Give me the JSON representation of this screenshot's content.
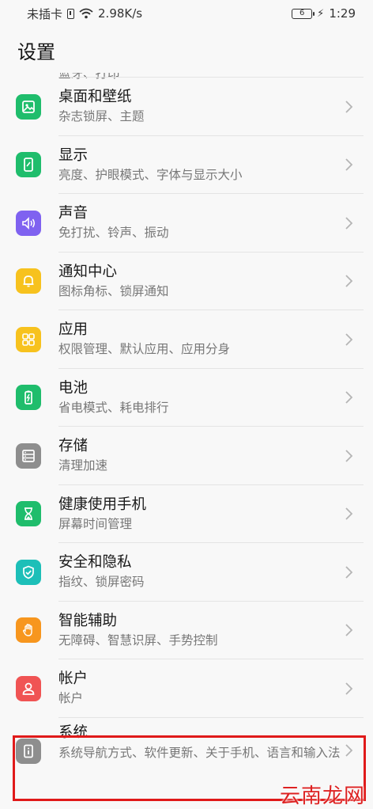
{
  "status_bar": {
    "carrier": "未插卡",
    "speed": "2.98K/s",
    "battery": "6",
    "time": "1:29"
  },
  "header": {
    "title": "设置"
  },
  "items": [
    {
      "title": "",
      "subtitle": "蓝牙、打印",
      "color": "#3d8bf2",
      "icon": "bluetooth-icon"
    },
    {
      "title": "桌面和壁纸",
      "subtitle": "杂志锁屏、主题",
      "color": "#1fbd6c",
      "icon": "wallpaper-icon"
    },
    {
      "title": "显示",
      "subtitle": "亮度、护眼模式、字体与显示大小",
      "color": "#1fbd6c",
      "icon": "display-icon"
    },
    {
      "title": "声音",
      "subtitle": "免打扰、铃声、振动",
      "color": "#7f62f0",
      "icon": "sound-icon"
    },
    {
      "title": "通知中心",
      "subtitle": "图标角标、锁屏通知",
      "color": "#f7c21e",
      "icon": "bell-icon"
    },
    {
      "title": "应用",
      "subtitle": "权限管理、默认应用、应用分身",
      "color": "#f7c21e",
      "icon": "apps-grid-icon"
    },
    {
      "title": "电池",
      "subtitle": "省电模式、耗电排行",
      "color": "#1fbd6c",
      "icon": "battery-icon"
    },
    {
      "title": "存储",
      "subtitle": "清理加速",
      "color": "#8e8e8e",
      "icon": "storage-icon"
    },
    {
      "title": "健康使用手机",
      "subtitle": "屏幕时间管理",
      "color": "#1fbd6c",
      "icon": "hourglass-icon"
    },
    {
      "title": "安全和隐私",
      "subtitle": "指纹、锁屏密码",
      "color": "#1dbfb8",
      "icon": "shield-icon"
    },
    {
      "title": "智能辅助",
      "subtitle": "无障碍、智慧识屏、手势控制",
      "color": "#f7961e",
      "icon": "hand-icon"
    },
    {
      "title": "帐户",
      "subtitle": "帐户",
      "color": "#f05454",
      "icon": "user-icon"
    },
    {
      "title": "系统",
      "subtitle": "系统导航方式、软件更新、关于手机、语言和输入法",
      "color": "#8e8e8e",
      "icon": "info-icon"
    }
  ],
  "watermark": "云南龙网"
}
